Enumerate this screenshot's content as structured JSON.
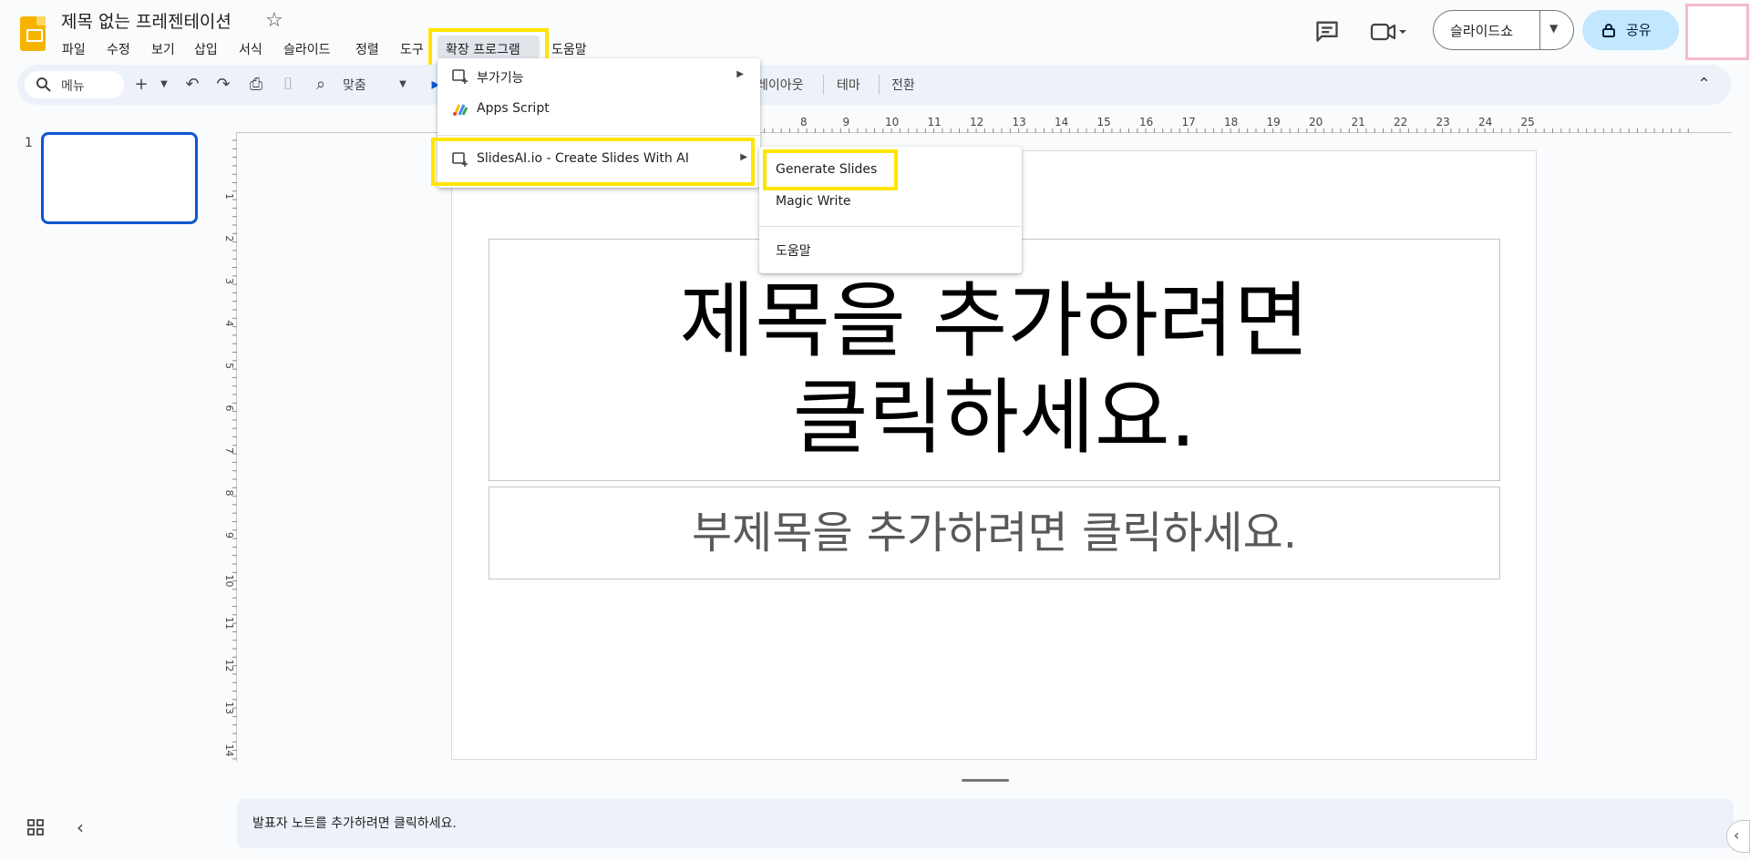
{
  "header": {
    "doc_title": "제목 없는 프레젠테이션",
    "menus": [
      "파일",
      "수정",
      "보기",
      "삽입",
      "서식",
      "슬라이드",
      "정렬",
      "도구",
      "확장 프로그램",
      "도움말"
    ],
    "slideshow_label": "슬라이드쇼",
    "share_label": "공유"
  },
  "toolbar": {
    "search_placeholder": "메뉴",
    "zoom_label": "맞춤",
    "layout_label": "레이아웃",
    "theme_label": "테마",
    "transition_label": "전환"
  },
  "filmstrip": {
    "slide_number": "1"
  },
  "ruler": {
    "top_ticks": [
      "8",
      "9",
      "10",
      "11",
      "12",
      "13",
      "14",
      "15",
      "16",
      "17",
      "18",
      "19",
      "20",
      "21",
      "22",
      "23",
      "24",
      "25"
    ],
    "left_ticks": [
      "1",
      "2",
      "3",
      "4",
      "5",
      "6",
      "7",
      "8",
      "9",
      "10",
      "11",
      "12",
      "13",
      "14"
    ]
  },
  "slide": {
    "title_line1": "제목을 추가하려면",
    "title_line2": "클릭하세요.",
    "subtitle": "부제목을 추가하려면 클릭하세요."
  },
  "notes": {
    "placeholder": "발표자 노트를 추가하려면 클릭하세요."
  },
  "extensions_menu": {
    "items": [
      {
        "label": "부가기능",
        "icon": "addon-icon",
        "has_submenu": true
      },
      {
        "label": "Apps Script",
        "icon": "apps-script-icon",
        "has_submenu": false
      },
      {
        "label": "SlidesAI.io - Create Slides With AI",
        "icon": "addon-icon",
        "has_submenu": true
      }
    ]
  },
  "slidesai_submenu": {
    "items": [
      "Generate Slides",
      "Magic Write",
      "도움말"
    ]
  },
  "colors": {
    "highlight": "#ffe500",
    "accent": "#0b57d0",
    "share_bg": "#c2e7ff"
  }
}
